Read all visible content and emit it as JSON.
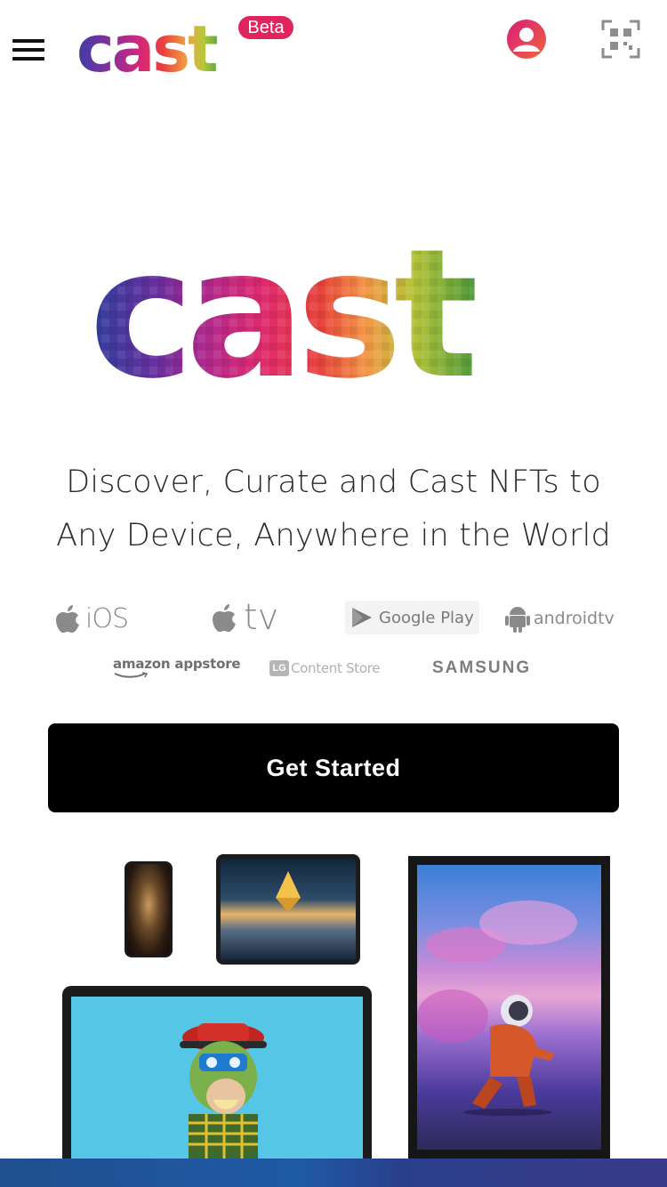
{
  "header": {
    "menu_icon": "hamburger-menu-icon",
    "logo_text": "cast",
    "beta_label": "Beta",
    "profile_icon": "user-profile-icon",
    "qr_icon": "qr-scan-icon"
  },
  "hero": {
    "logo_text": "cast",
    "headline_line1": "Discover, Curate and Cast NFTs to",
    "headline_line2": "Any Device, Anywhere in the World"
  },
  "platforms": {
    "ios": "iOS",
    "appletv": "tv",
    "googleplay": "Google Play",
    "androidtv": "androidtv",
    "amazon": "amazon appstore",
    "lg_badge": "LG",
    "lg": "Content Store",
    "samsung": "SAMSUNG"
  },
  "cta": {
    "label": "Get Started"
  },
  "colors": {
    "beta": "#e0245e",
    "cta_bg": "#000000",
    "cta_text": "#ffffff",
    "bottom_bar": "#1f5aa5"
  }
}
